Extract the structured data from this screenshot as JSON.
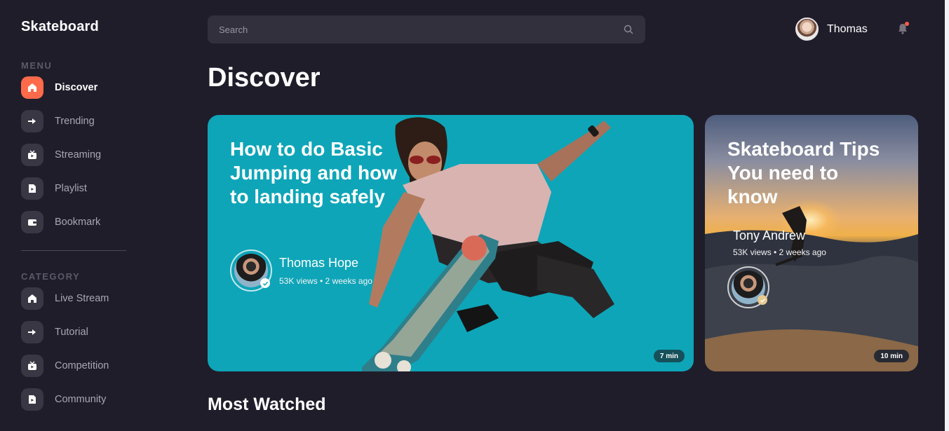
{
  "sidebar": {
    "logo": "Skateboard",
    "menu_title": "MENU",
    "menu_items": [
      {
        "label": "Discover",
        "icon": "home-icon",
        "active": true
      },
      {
        "label": "Trending",
        "icon": "arrow-right-icon"
      },
      {
        "label": "Streaming",
        "icon": "tv-icon"
      },
      {
        "label": "Playlist",
        "icon": "playlist-icon"
      },
      {
        "label": "Bookmark",
        "icon": "wallet-icon"
      }
    ],
    "category_title": "CATEGORY",
    "category_items": [
      {
        "label": "Live Stream",
        "icon": "home-icon"
      },
      {
        "label": "Tutorial",
        "icon": "arrow-right-icon"
      },
      {
        "label": "Competition",
        "icon": "tv-icon"
      },
      {
        "label": "Community",
        "icon": "playlist-icon"
      }
    ]
  },
  "header": {
    "search_placeholder": "Search",
    "user_name": "Thomas",
    "notification_icon": "bell-icon"
  },
  "main": {
    "title": "Discover",
    "featured": {
      "title": "How to do Basic Jumping and how to landing safely",
      "author": "Thomas Hope",
      "stats": "53K views • 2 weeks ago",
      "duration": "7 min",
      "background": "#0ea5b8"
    },
    "secondary": {
      "title": "Skateboard Tips You need to know",
      "author": "Tony Andrew",
      "stats": "53K views • 2 weeks ago",
      "duration": "10 min"
    },
    "section_heading": "Most Watched"
  },
  "colors": {
    "background": "#201d2b",
    "accent": "#ff6b4a",
    "icon_bg": "#3a3744"
  }
}
